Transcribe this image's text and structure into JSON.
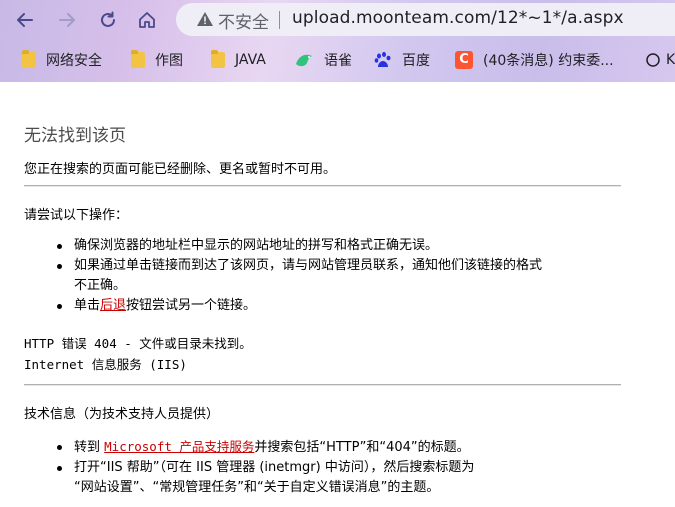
{
  "browser": {
    "insecure_label": "不安全",
    "url": "upload.moonteam.com/12*~1*/a.aspx",
    "bookmarks": [
      {
        "label": "网络安全",
        "icon": "folder-icon"
      },
      {
        "label": "作图",
        "icon": "folder-icon"
      },
      {
        "label": "JAVA",
        "icon": "folder-icon"
      },
      {
        "label": "语雀",
        "icon": "yuque-icon"
      },
      {
        "label": "百度",
        "icon": "baidu-paw-icon"
      },
      {
        "label": "(40条消息) 约束委...",
        "icon": "csdn-icon",
        "icon_text": "C"
      },
      {
        "label": "K",
        "icon": "k-icon"
      }
    ]
  },
  "page": {
    "title": "无法找到该页",
    "subtitle": "您正在搜索的页面可能已经删除、更名或暂时不可用。",
    "try_heading": "请尝试以下操作：",
    "try_items": [
      "确保浏览器的地址栏中显示的网站地址的拼写和格式正确无误。",
      "如果通过单击链接而到达了该网页，请与网站管理员联系，通知他们该链接的格式",
      "不正确。"
    ],
    "back_prefix": "单击",
    "back_link": "后退",
    "back_suffix": "按钮尝试另一个链接。",
    "error_line1": "HTTP 错误 404 - 文件或目录未找到。",
    "error_line2": "Internet 信息服务 (IIS)",
    "tech_heading": "技术信息（为技术支持人员提供）",
    "tech_item1_prefix": "转到 ",
    "tech_item1_link": "Microsoft 产品支持服务",
    "tech_item1_suffix": "并搜索包括“HTTP”和“404”的标题。",
    "tech_item2_line1": "打开“IIS 帮助”（可在 IIS 管理器 (inetmgr) 中访问），然后搜索标题为",
    "tech_item2_line2": "“网站设置”、“常规管理任务”和“关于自定义错误消息”的主题。"
  },
  "colors": {
    "link": "#cc0000",
    "title": "#4d4d4d"
  }
}
